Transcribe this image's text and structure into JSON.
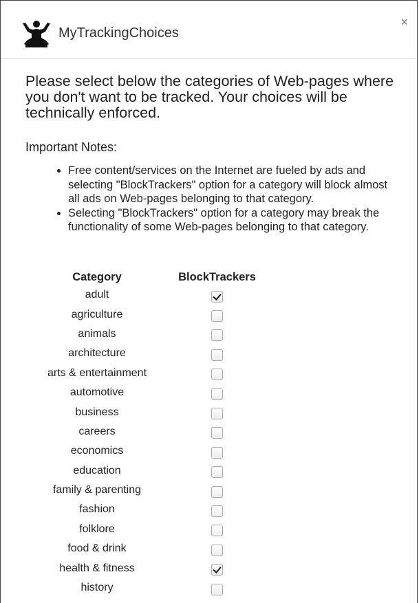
{
  "header": {
    "title": "MyTrackingChoices",
    "close_label": "×",
    "logo_icon": "meditating-person-icon"
  },
  "intro": {
    "text": "Please select below the categories of Web-pages where you don't want to be tracked. Your choices will be technically enforced."
  },
  "notes": {
    "heading": "Important Notes:",
    "items": [
      "Free content/services on the Internet are fueled by ads and selecting \"BlockTrackers\" option for a category will block almost all ads on Web-pages belonging to that category.",
      "Selecting \"BlockTrackers\" option for a category may break the functionality of some Web-pages belonging to that category."
    ]
  },
  "table": {
    "headers": {
      "category": "Category",
      "block": "BlockTrackers"
    },
    "rows": [
      {
        "category": "adult",
        "blocked": true
      },
      {
        "category": "agriculture",
        "blocked": false
      },
      {
        "category": "animals",
        "blocked": false
      },
      {
        "category": "architecture",
        "blocked": false
      },
      {
        "category": "arts & entertainment",
        "blocked": false
      },
      {
        "category": "automotive",
        "blocked": false
      },
      {
        "category": "business",
        "blocked": false
      },
      {
        "category": "careers",
        "blocked": false
      },
      {
        "category": "economics",
        "blocked": false
      },
      {
        "category": "education",
        "blocked": false
      },
      {
        "category": "family & parenting",
        "blocked": false
      },
      {
        "category": "fashion",
        "blocked": false
      },
      {
        "category": "folklore",
        "blocked": false
      },
      {
        "category": "food & drink",
        "blocked": false
      },
      {
        "category": "health & fitness",
        "blocked": true
      },
      {
        "category": "history",
        "blocked": false
      }
    ]
  }
}
